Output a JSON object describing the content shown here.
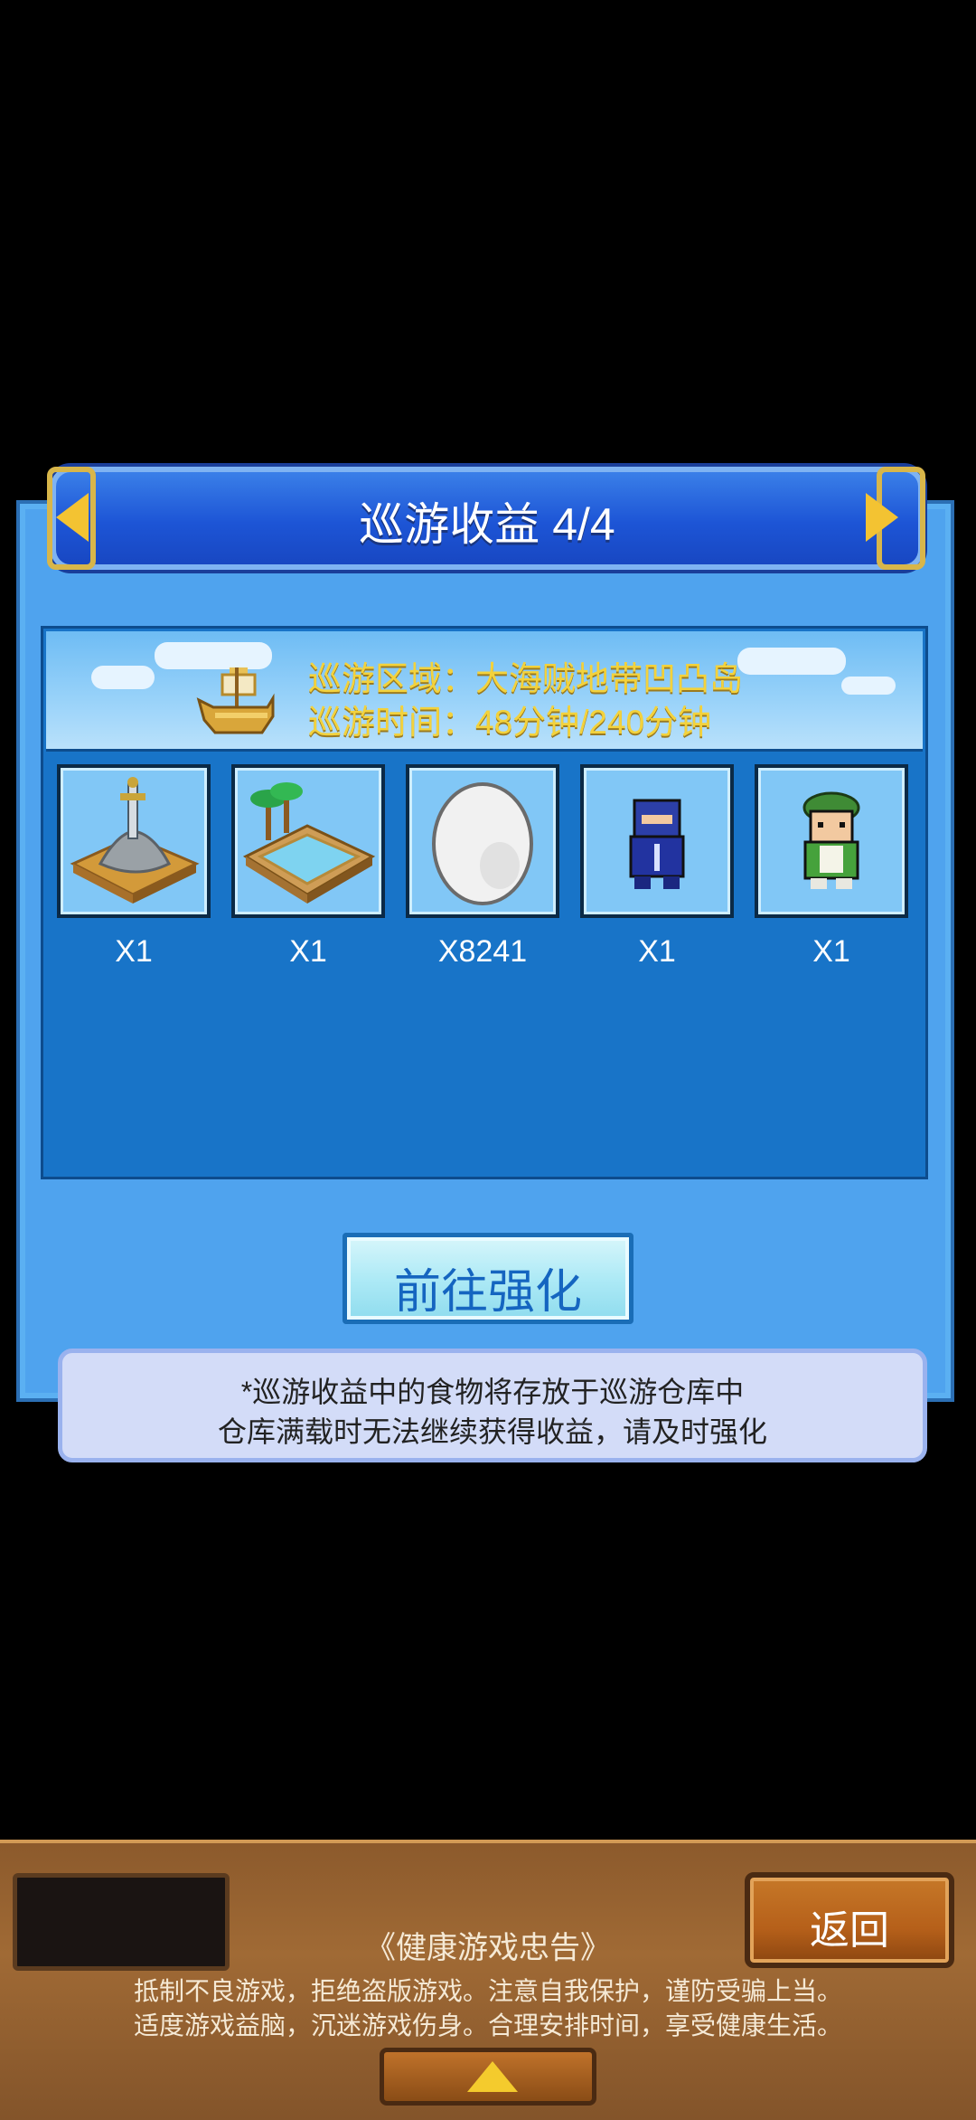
{
  "dialog": {
    "title": "巡游收益 4/4",
    "area_line": "巡游区域：大海贼地带凹凸岛",
    "time_line": "巡游时间：48分钟/240分钟",
    "items": [
      {
        "name": "sword-monument",
        "qty": "X1"
      },
      {
        "name": "pool",
        "qty": "X1"
      },
      {
        "name": "egg",
        "qty": "X8241"
      },
      {
        "name": "ninja-character",
        "qty": "X1"
      },
      {
        "name": "green-cap-character",
        "qty": "X1"
      }
    ],
    "enhance_label": "前往强化",
    "notice_line1": "*巡游收益中的食物将存放于巡游仓库中",
    "notice_line2": "仓库满载时无法继续获得收益，请及时强化"
  },
  "bottom": {
    "back_label": "返回",
    "health_title": "《健康游戏忠告》",
    "health_line1": "抵制不良游戏，拒绝盗版游戏。注意自我保护，谨防受骗上当。",
    "health_line2": "适度游戏益脑，沉迷游戏伤身。合理安排时间，享受健康生活。"
  },
  "colors": {
    "title_bar": "#1d55d6",
    "panel": "#1874c8",
    "info_text": "#f3d23c",
    "enhance_text": "#1565c0"
  }
}
